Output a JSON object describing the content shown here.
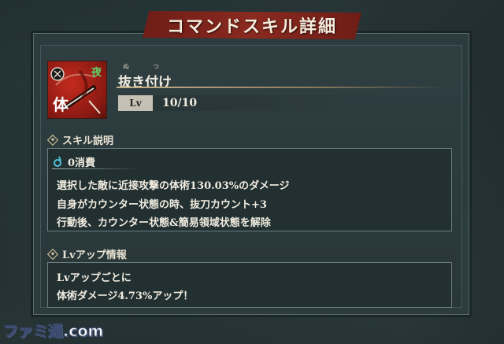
{
  "title": "コマンドスキル詳細",
  "skill": {
    "ruby_nu": "ぬ",
    "ruby_tsu": "つ",
    "name": "抜き付け",
    "level_label": "Lv",
    "level_value": "10/10",
    "attr_badge": "体",
    "time_badge": "夜"
  },
  "description_section": {
    "header": "スキル説明",
    "cost": "0消費",
    "lines": [
      "選択した敵に近接攻撃の体術130.03%のダメージ",
      "自身がカウンター状態の時、抜刀カウント+3",
      "行動後、カウンター状態&簡易領域状態を解除"
    ]
  },
  "levelup_section": {
    "header": "Lvアップ情報",
    "lines": [
      "Lvアップごとに",
      "体術ダメージ4.73%アップ！"
    ]
  },
  "watermark": "ファミ通.com",
  "colors": {
    "banner": "#7a231b",
    "icon_bg": "#b3261b",
    "panel": "#2c3b3d",
    "text": "#f1ece0",
    "cost_icon": "#4fc3d9"
  }
}
